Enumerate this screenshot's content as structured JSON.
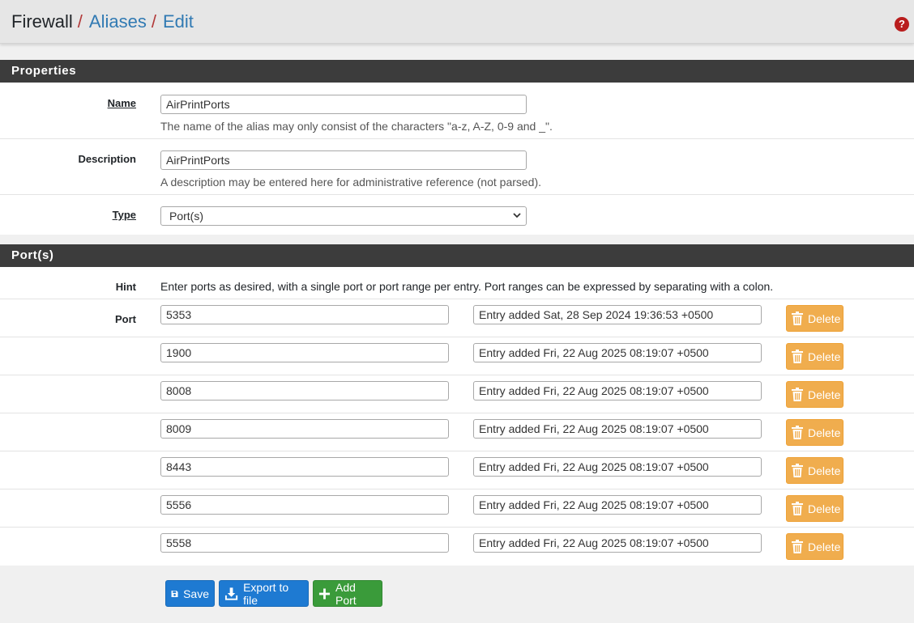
{
  "breadcrumb": {
    "root": "Firewall",
    "aliases": "Aliases",
    "edit": "Edit",
    "sep": "/"
  },
  "help_icon": "?",
  "properties": {
    "heading": "Properties",
    "name": {
      "label": "Name",
      "value": "AirPrintPorts",
      "help": "The name of the alias may only consist of the characters \"a-z, A-Z, 0-9 and _\"."
    },
    "description": {
      "label": "Description",
      "value": "AirPrintPorts",
      "help": "A description may be entered here for administrative reference (not parsed)."
    },
    "type": {
      "label": "Type",
      "value": "Port(s)"
    }
  },
  "ports": {
    "heading": "Port(s)",
    "hint_label": "Hint",
    "hint": "Enter ports as desired, with a single port or port range per entry. Port ranges can be expressed by separating with a colon.",
    "port_label": "Port",
    "delete_label": "Delete",
    "rows": [
      {
        "port": "5353",
        "desc": "Entry added Sat, 28 Sep 2024 19:36:53 +0500"
      },
      {
        "port": "1900",
        "desc": "Entry added Fri, 22 Aug 2025 08:19:07 +0500"
      },
      {
        "port": "8008",
        "desc": "Entry added Fri, 22 Aug 2025 08:19:07 +0500"
      },
      {
        "port": "8009",
        "desc": "Entry added Fri, 22 Aug 2025 08:19:07 +0500"
      },
      {
        "port": "8443",
        "desc": "Entry added Fri, 22 Aug 2025 08:19:07 +0500"
      },
      {
        "port": "5556",
        "desc": "Entry added Fri, 22 Aug 2025 08:19:07 +0500"
      },
      {
        "port": "5558",
        "desc": "Entry added Fri, 22 Aug 2025 08:19:07 +0500"
      }
    ]
  },
  "actions": {
    "save": "Save",
    "export": "Export to file",
    "add_port": "Add Port"
  },
  "colors": {
    "delete": "#f0ad4e",
    "primary": "#1e7ad2",
    "success": "#3a9b3a",
    "heading": "#3c3c3c"
  }
}
